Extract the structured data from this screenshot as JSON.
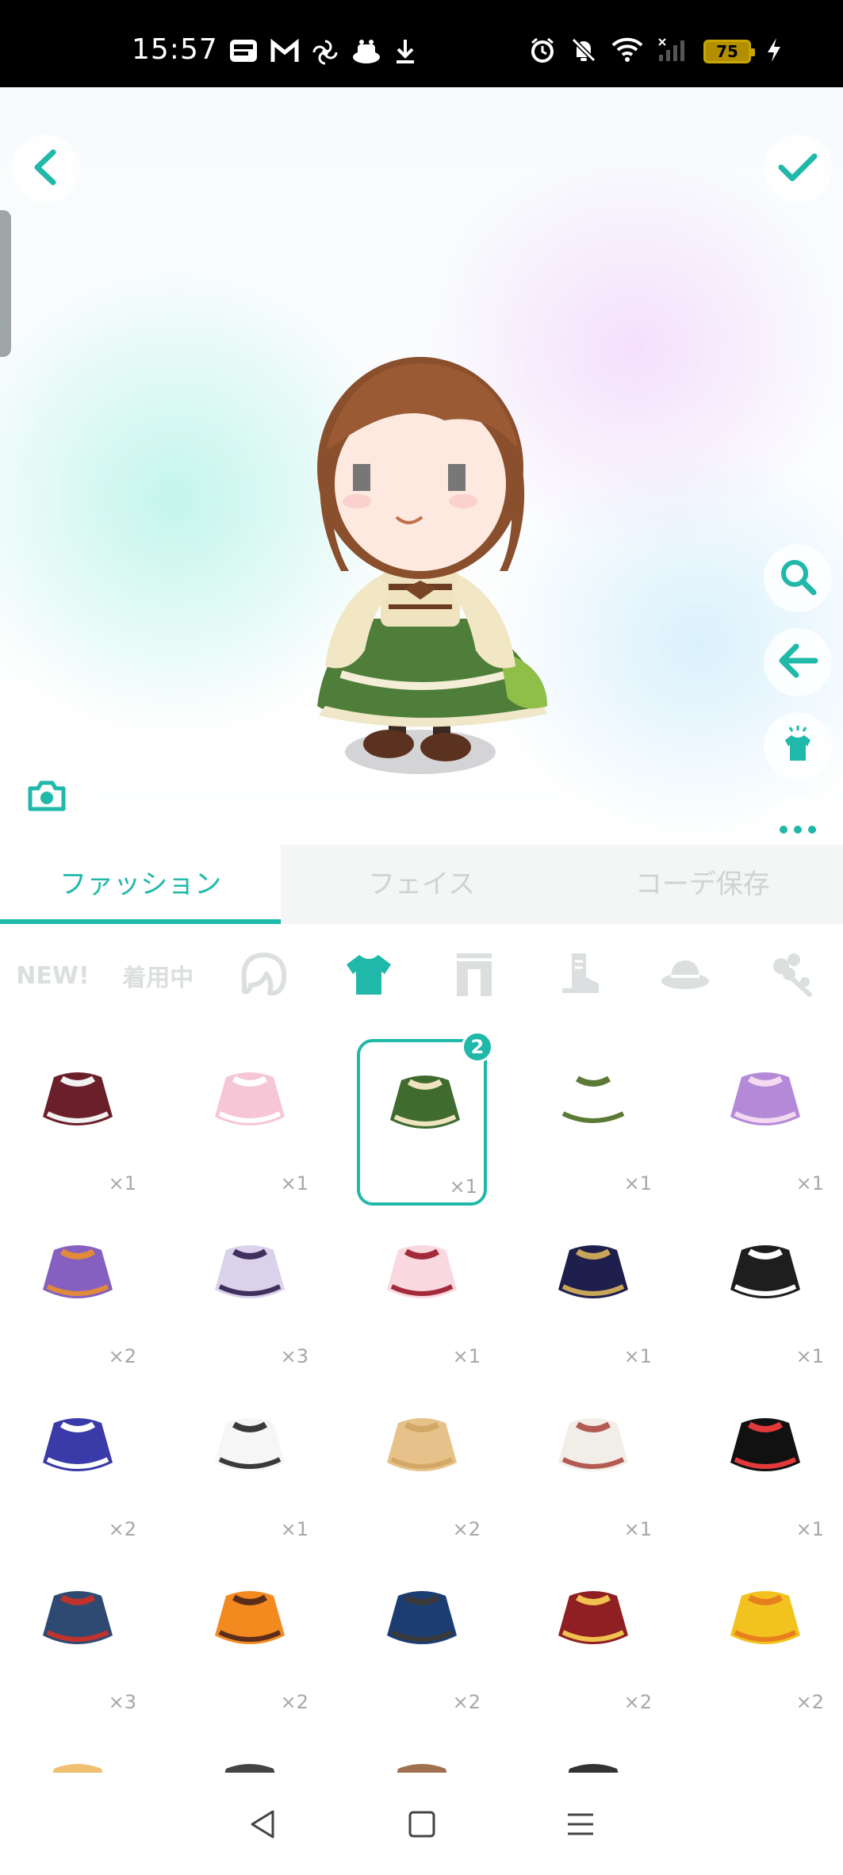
{
  "status_bar": {
    "time": "15:57",
    "battery": "75",
    "left_icons": [
      "line-manga-icon",
      "gmail-icon",
      "pinwheel-icon",
      "app-icon",
      "download-icon"
    ],
    "right_icons": [
      "alarm-icon",
      "bell-off-icon",
      "wifi-icon",
      "signal-icon",
      "battery-icon",
      "charging-icon"
    ]
  },
  "stage": {
    "top_left_icon": "chevron-left-icon",
    "top_right_icon": "check-icon",
    "camera_icon": "camera-icon",
    "tools": [
      "search-icon",
      "arrow-left-icon",
      "outfit-icon",
      "more-icon"
    ]
  },
  "tabs": [
    {
      "label": "ファッション",
      "active": true
    },
    {
      "label": "フェイス",
      "active": false
    },
    {
      "label": "コーデ保存",
      "active": false
    }
  ],
  "categories": [
    {
      "label": "NEW!",
      "kind": "text"
    },
    {
      "label": "着用中",
      "kind": "text"
    },
    {
      "icon": "hair-icon"
    },
    {
      "icon": "tshirt-icon",
      "active": true
    },
    {
      "icon": "pants-icon"
    },
    {
      "icon": "boot-icon"
    },
    {
      "icon": "hat-icon"
    },
    {
      "icon": "accessory-icon"
    }
  ],
  "items": [
    {
      "count": "×1",
      "color": "#6b1f2a",
      "accent": "#f2f2f2"
    },
    {
      "count": "×1",
      "color": "#f7c6d6",
      "accent": "#ffffff"
    },
    {
      "count": "×1",
      "color": "#3f6b2f",
      "accent": "#efe3c0",
      "selected": true,
      "badge": "2"
    },
    {
      "count": "×1",
      "color": "#ffffff",
      "accent": "#5c7a35"
    },
    {
      "count": "×1",
      "color": "#b48ad8",
      "accent": "#f5d9f0"
    },
    {
      "count": "×2",
      "color": "#8560c0",
      "accent": "#e08b3a"
    },
    {
      "count": "×3",
      "color": "#d9d2ea",
      "accent": "#40305e"
    },
    {
      "count": "×1",
      "color": "#f9d8df",
      "accent": "#a32a3a"
    },
    {
      "count": "×1",
      "color": "#1f1f4d",
      "accent": "#c8a659"
    },
    {
      "count": "×1",
      "color": "#1e1e1e",
      "accent": "#ffffff"
    },
    {
      "count": "×2",
      "color": "#3a3aa8",
      "accent": "#ffffff"
    },
    {
      "count": "×1",
      "color": "#f6f6f6",
      "accent": "#3a3a3a"
    },
    {
      "count": "×2",
      "color": "#e6c28a",
      "accent": "#d2a867"
    },
    {
      "count": "×1",
      "color": "#f1ede7",
      "accent": "#b35a52"
    },
    {
      "count": "×1",
      "color": "#111111",
      "accent": "#e23a3a"
    },
    {
      "count": "×3",
      "color": "#2e4a72",
      "accent": "#c0322c"
    },
    {
      "count": "×2",
      "color": "#f28a1f",
      "accent": "#5b2d1a"
    },
    {
      "count": "×2",
      "color": "#1b3d72",
      "accent": "#3a3a3a"
    },
    {
      "count": "×2",
      "color": "#8f1f22",
      "accent": "#f1c24f"
    },
    {
      "count": "×2",
      "color": "#f2c21e",
      "accent": "#e77f1f"
    },
    {
      "count": "",
      "color": "#f0c070",
      "accent": "#f0c070"
    },
    {
      "count": "",
      "color": "#444444",
      "accent": "#444444"
    },
    {
      "count": "",
      "color": "#a07050",
      "accent": "#a07050"
    },
    {
      "count": "",
      "color": "#333333",
      "accent": "#333333"
    }
  ],
  "navbar": [
    "back-triangle-icon",
    "home-square-icon",
    "menu-lines-icon"
  ]
}
